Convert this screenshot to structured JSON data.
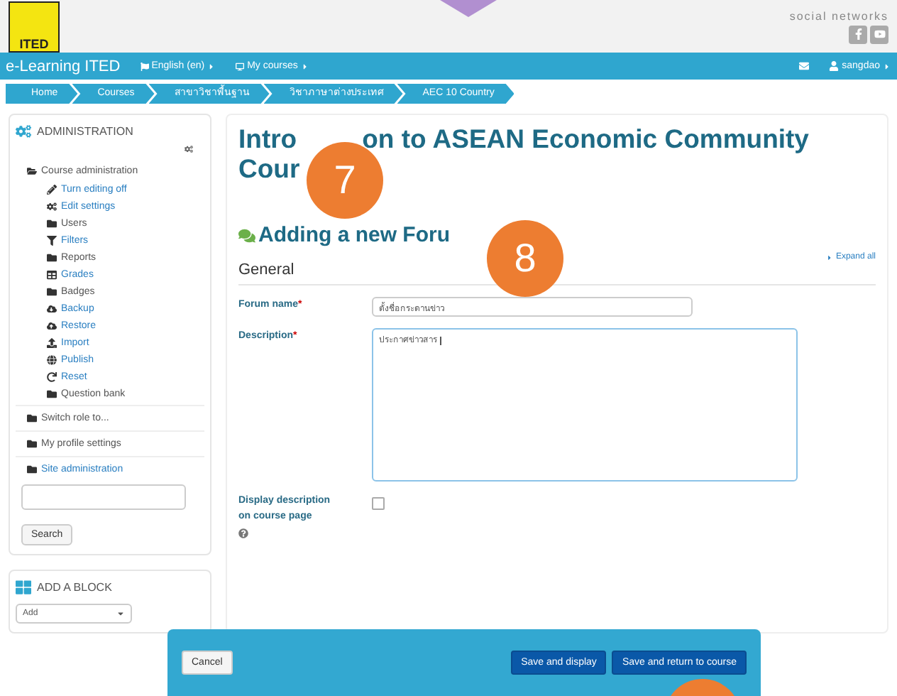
{
  "header": {
    "logo_text": "ITED",
    "social_label": "social networks"
  },
  "navbar": {
    "brand": "e-Learning ITED",
    "menus": [
      {
        "label": "English (en)",
        "kind": "language"
      },
      {
        "label": "My courses",
        "kind": "courses"
      }
    ],
    "user": "sangdao"
  },
  "breadcrumbs": [
    "Home",
    "Courses",
    "สาขาวิชาพื้นฐาน",
    "วิชาภาษาต่างประเทศ",
    "AEC 10 Country"
  ],
  "administration": {
    "title": "ADMINISTRATION",
    "items": [
      {
        "label": "Course administration",
        "kind": "folder",
        "link": false,
        "expanded": true,
        "children": [
          {
            "label": "Turn editing off",
            "kind": "pencil",
            "link": true
          },
          {
            "label": "Edit settings",
            "kind": "gear",
            "link": true
          },
          {
            "label": "Users",
            "kind": "folder",
            "link": false
          },
          {
            "label": "Filters",
            "kind": "filter",
            "link": true
          },
          {
            "label": "Reports",
            "kind": "folder",
            "link": false
          },
          {
            "label": "Grades",
            "kind": "grid",
            "link": true
          },
          {
            "label": "Badges",
            "kind": "folder",
            "link": false
          },
          {
            "label": "Backup",
            "kind": "cloud-down",
            "link": true
          },
          {
            "label": "Restore",
            "kind": "cloud-up",
            "link": true
          },
          {
            "label": "Import",
            "kind": "upload",
            "link": true
          },
          {
            "label": "Publish",
            "kind": "globe",
            "link": true
          },
          {
            "label": "Reset",
            "kind": "reset",
            "link": true
          },
          {
            "label": "Question bank",
            "kind": "folder",
            "link": false
          }
        ]
      },
      {
        "label": "Switch role to...",
        "kind": "folder",
        "link": false,
        "expanded": false
      },
      {
        "label": "My profile settings",
        "kind": "folder",
        "link": false,
        "expanded": false
      },
      {
        "label": "Site administration",
        "kind": "folder",
        "link": true,
        "expanded": false
      }
    ],
    "search_button": "Search"
  },
  "add_block": {
    "title": "ADD A BLOCK",
    "select": "Add"
  },
  "main": {
    "course_title_parts": [
      "Intro",
      "on to ASEAN Economic Community",
      "Cour"
    ],
    "heading": "Adding a new Foru",
    "expand_all": "Expand all",
    "section": "General",
    "fields": [
      {
        "kind": "text",
        "label": "Forum name",
        "required_mark": "*",
        "value": "ตั้งชื่อกระดานข่าว"
      },
      {
        "kind": "textarea",
        "label": "Description",
        "required_mark": "*",
        "value": "ประกาศข่าวสาร"
      },
      {
        "kind": "checkbox",
        "label": "Display description on course page",
        "checked": false,
        "help": true
      }
    ]
  },
  "footer_bar": {
    "cancel": "Cancel",
    "buttons": [
      "Save and display",
      "Save and return to course"
    ]
  },
  "callouts": [
    "7",
    "8"
  ]
}
